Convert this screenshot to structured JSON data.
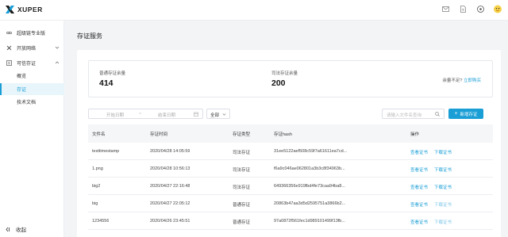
{
  "app": {
    "name": "XUPER"
  },
  "header": {
    "icons": [
      "mail-icon",
      "document-icon",
      "compass-icon",
      "avatar"
    ]
  },
  "sidebar": {
    "items": [
      {
        "label": "超级链专业版",
        "icon": "chain-icon"
      },
      {
        "label": "开放网络",
        "icon": "network-icon"
      },
      {
        "label": "可信存证",
        "icon": "certificate-icon"
      }
    ],
    "subitems": [
      {
        "label": "概览"
      },
      {
        "label": "存证"
      },
      {
        "label": "技术文档"
      }
    ],
    "collapse_label": "收起"
  },
  "page": {
    "title": "存证服务"
  },
  "stats": {
    "normal_label": "普通存证余量",
    "normal_value": "414",
    "judicial_label": "司法存证余量",
    "judicial_value": "200",
    "low_text": "余量不足?",
    "buy_link": "立即购买"
  },
  "filters": {
    "start_placeholder": "开始日期",
    "separator": "~",
    "end_placeholder": "结束日期",
    "type_value": "全部",
    "search_placeholder": "请输入文件名查询",
    "add_label": "新增存证"
  },
  "table": {
    "headers": [
      "文件名",
      "存证时间",
      "存证类型",
      "存证hash",
      "操作"
    ],
    "rows": [
      {
        "name": "testtimestamp",
        "time": "2020/04/28 14:05:59",
        "type": "司法存证",
        "hash": "31ee5122aef508c59f7a61611ea7cd...",
        "view": "查看证书",
        "download": "下载证书"
      },
      {
        "name": "1.png",
        "time": "2020/04/28 10:56:13",
        "type": "司法存证",
        "hash": "f6a9c046ae062801a3b3c8f34963b...",
        "view": "查看证书",
        "download": "下载证书"
      },
      {
        "name": "big2",
        "time": "2020/04/27 22:16:48",
        "type": "司法存证",
        "hash": "649366356e919fbd4fe73caa94ba8...",
        "view": "查看证书",
        "download": "下载证书"
      },
      {
        "name": "big",
        "time": "2020/04/27 22:05:12",
        "type": "普通存证",
        "hash": "20863b47aa3d5d2595751a3866b2...",
        "view": "查看证书",
        "download": "下载证书"
      },
      {
        "name": "1234556",
        "time": "2020/04/26 23:45:51",
        "type": "普通存证",
        "hash": "97a0872f561fec1d989101499f13fb...",
        "view": "查看证书",
        "download": "下载证书"
      }
    ]
  },
  "colors": {
    "accent": "#1a9ed6",
    "active_bg": "#e8f6fb"
  }
}
